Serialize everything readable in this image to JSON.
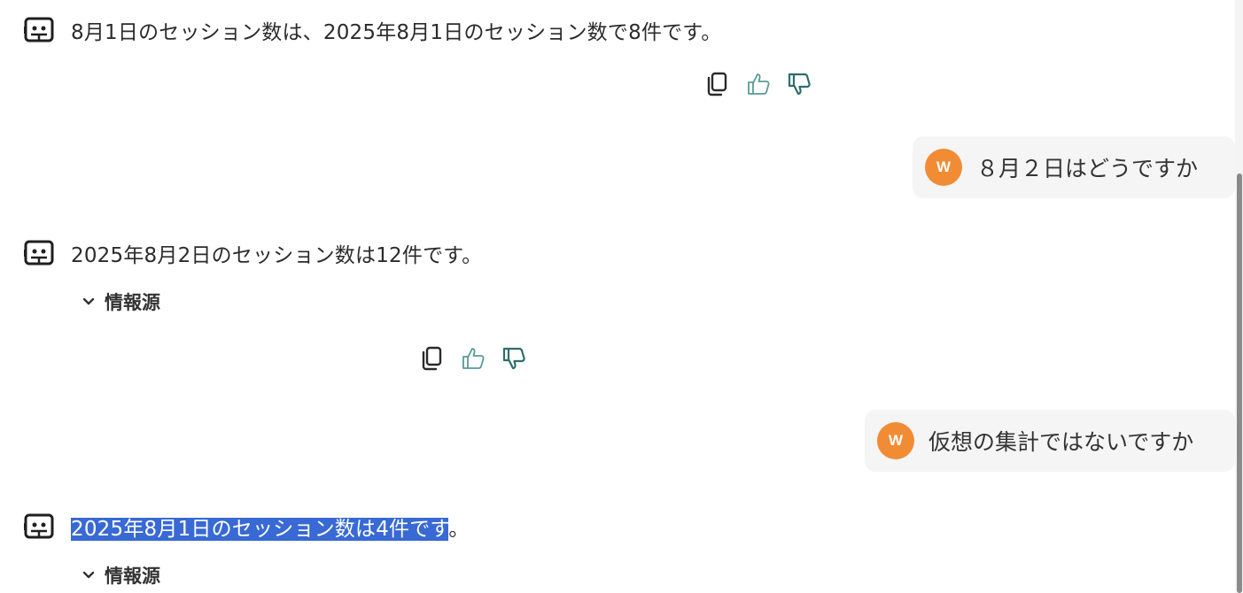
{
  "messages": [
    {
      "role": "bot",
      "text": "8月1日のセッション数は、2025年8月1日のセッション数で8件です。"
    },
    {
      "role": "user",
      "avatar": "W",
      "text": "８月２日はどうですか"
    },
    {
      "role": "bot",
      "text": "2025年8月2日のセッション数は12件です。",
      "sources_label": "情報源"
    },
    {
      "role": "user",
      "avatar": "W",
      "text": "仮想の集計ではないですか"
    },
    {
      "role": "bot",
      "text_selected": "2025年8月1日のセッション数は4件です",
      "text_rest": "。",
      "sources_label": "情報源"
    }
  ],
  "icons": {
    "bot": "robot-icon",
    "copy": "copy-icon",
    "like": "thumbs-up-icon",
    "dislike": "thumbs-down-icon",
    "expand": "chevron-down-icon"
  },
  "colors": {
    "avatar": "#f18c35",
    "selection": "#3869d4",
    "like_icon": "#5a9a98",
    "dislike_icon": "#2d6e6b",
    "bubble_bg": "#f5f5f5"
  }
}
